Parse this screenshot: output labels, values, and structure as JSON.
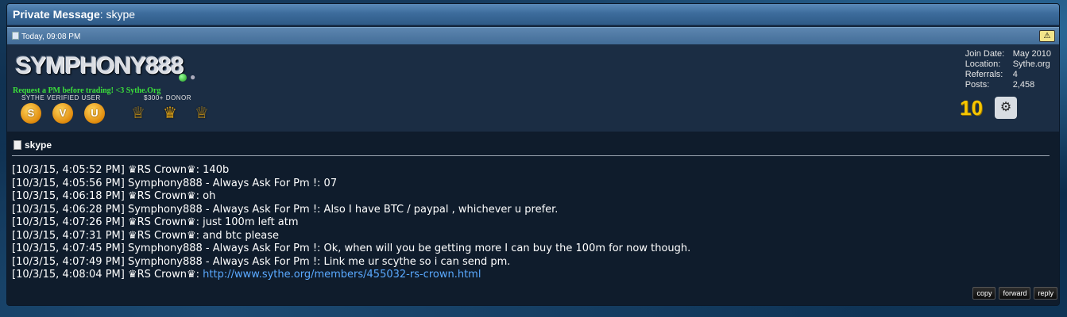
{
  "title": {
    "prefix": "Private Message",
    "suffix": ": skype"
  },
  "date": "Today, 09:08 PM",
  "report_icon": "warning-icon",
  "user": {
    "name": "SYMPHONY888",
    "title": "Request a PM before trading! <3 Sythe.Org",
    "badge_group_1_label": "SYTHE VERIFIED USER",
    "badge_group_2_label": "$300+ DONOR",
    "badges_1": [
      "S",
      "V",
      "U"
    ],
    "join_label": "Join Date:",
    "join_value": "May 2010",
    "location_label": "Location:",
    "location_value": "Sythe.org",
    "referrals_label": "Referrals:",
    "referrals_value": "4",
    "posts_label": "Posts:",
    "posts_value": "2,458",
    "award_10": "10"
  },
  "message": {
    "title": "skype",
    "lines": [
      "[10/3/15, 4:05:52 PM] ♛RS Crown♛: 140b",
      "[10/3/15, 4:05:56 PM] Symphony888 - Always Ask For Pm !: 07",
      "[10/3/15, 4:06:18 PM] ♛RS Crown♛: oh",
      "[10/3/15, 4:06:28 PM] Symphony888 - Always Ask For Pm !: Also I have BTC / paypal , whichever u prefer.",
      "[10/3/15, 4:07:26 PM] ♛RS Crown♛: just 100m left atm",
      "[10/3/15, 4:07:31 PM] ♛RS Crown♛: and btc please",
      "[10/3/15, 4:07:45 PM] Symphony888 - Always Ask For Pm !: Ok, when will you be getting more I can buy the 100m for now though.",
      "[10/3/15, 4:07:49 PM] Symphony888 - Always Ask For Pm !: Link me ur scythe so i can send pm."
    ],
    "last_line_prefix": "[10/3/15, 4:08:04 PM] ♛RS Crown♛: ",
    "last_line_link": "http://www.sythe.org/members/455032-rs-crown.html"
  },
  "buttons": {
    "copy": "copy",
    "forward": "forward",
    "reply": "reply"
  }
}
